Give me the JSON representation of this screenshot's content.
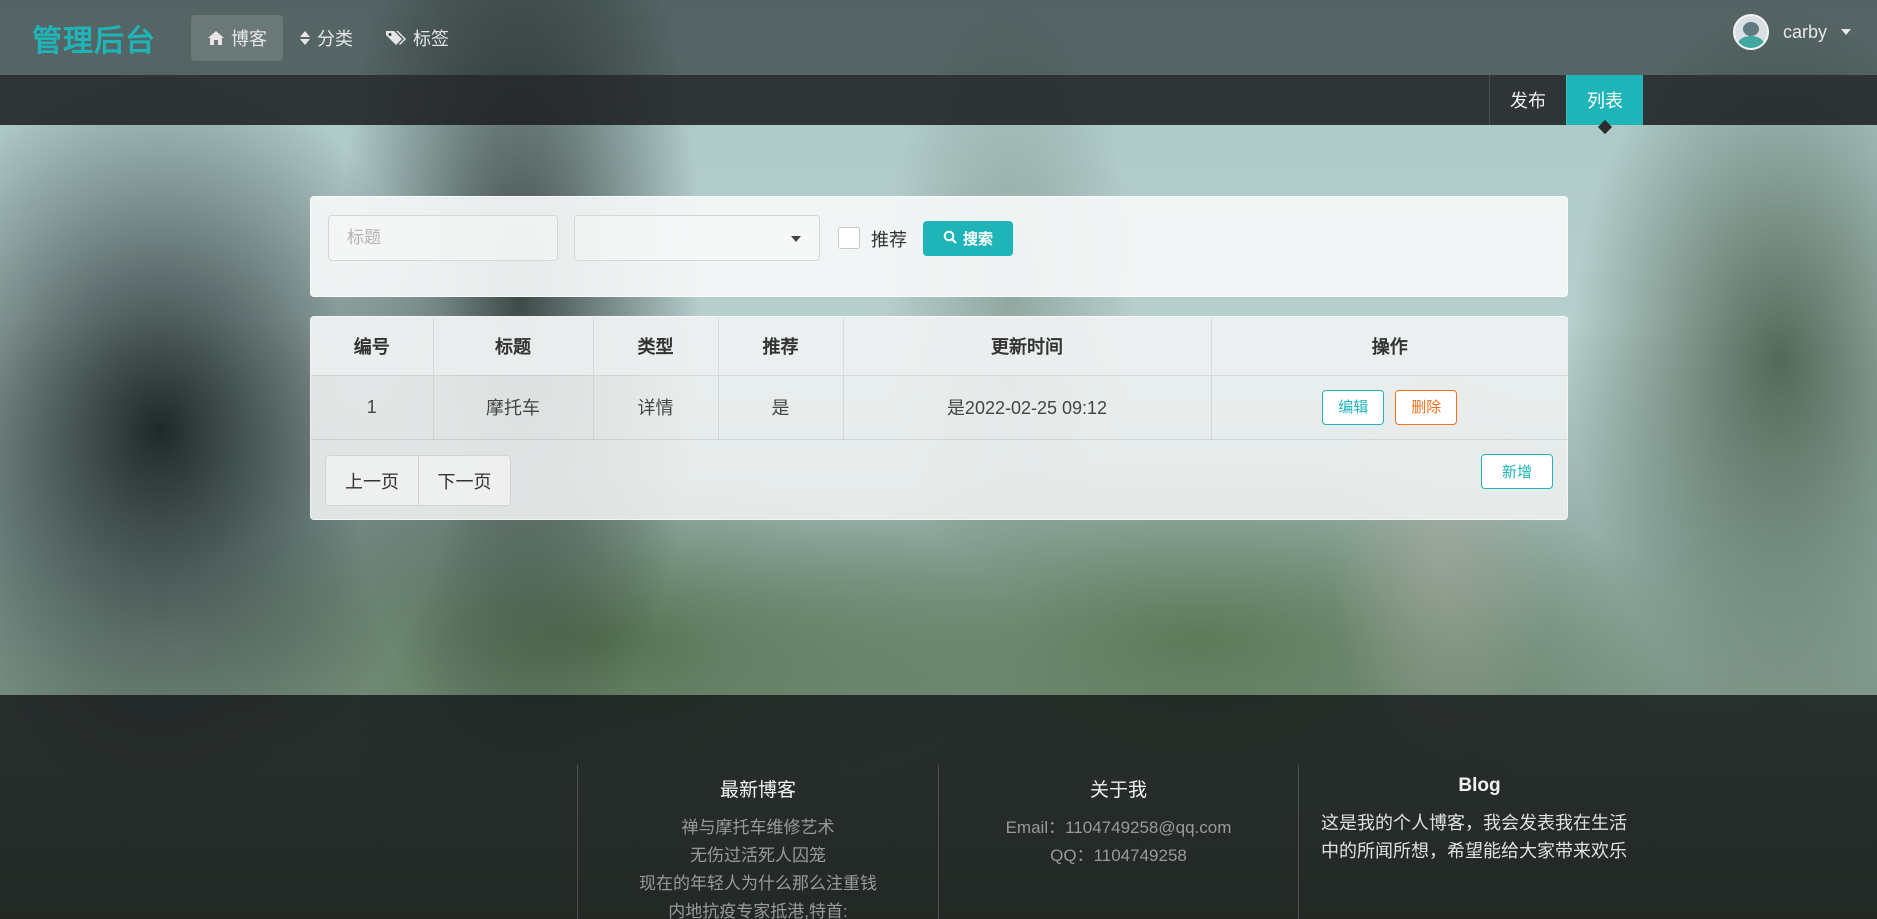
{
  "nav": {
    "brand": "管理后台",
    "items": [
      {
        "label": "博客",
        "icon": "home-icon"
      },
      {
        "label": "分类",
        "icon": "sort-icon"
      },
      {
        "label": "标签",
        "icon": "tags-icon"
      }
    ],
    "user": {
      "name": "carby"
    }
  },
  "subnav": {
    "tabs": [
      {
        "label": "发布"
      },
      {
        "label": "列表"
      }
    ]
  },
  "search": {
    "title_placeholder": "标题",
    "type_value": "",
    "recommend_label": "推荐",
    "recommend_checked": false,
    "button_label": "搜索"
  },
  "table": {
    "headers": [
      "编号",
      "标题",
      "类型",
      "推荐",
      "更新时间",
      "操作"
    ],
    "rows": [
      {
        "id": "1",
        "title": "摩托车",
        "type": "详情",
        "recommend": "是",
        "updated": "是2022-02-25 09:12",
        "edit": "编辑",
        "delete": "删除"
      }
    ]
  },
  "pager": {
    "prev": "上一页",
    "next": "下一页"
  },
  "add_label": "新增",
  "footer": {
    "latest": {
      "title": "最新博客",
      "items": [
        "禅与摩托车维修艺术",
        "无伤过活死人囚笼",
        "现在的年轻人为什么那么注重钱",
        "内地抗疫专家抵港,特首:"
      ]
    },
    "about": {
      "title": "关于我",
      "email": "Email：1104749258@qq.com",
      "qq": "QQ：1104749258"
    },
    "blog": {
      "title": "Blog",
      "desc_line1": "这是我的个人博客，我会发表我在生活",
      "desc_line2": "中的所闻所想，希望能给大家带来欢乐"
    }
  },
  "colors": {
    "accent": "#1fb5b8",
    "danger": "#f2711c"
  }
}
